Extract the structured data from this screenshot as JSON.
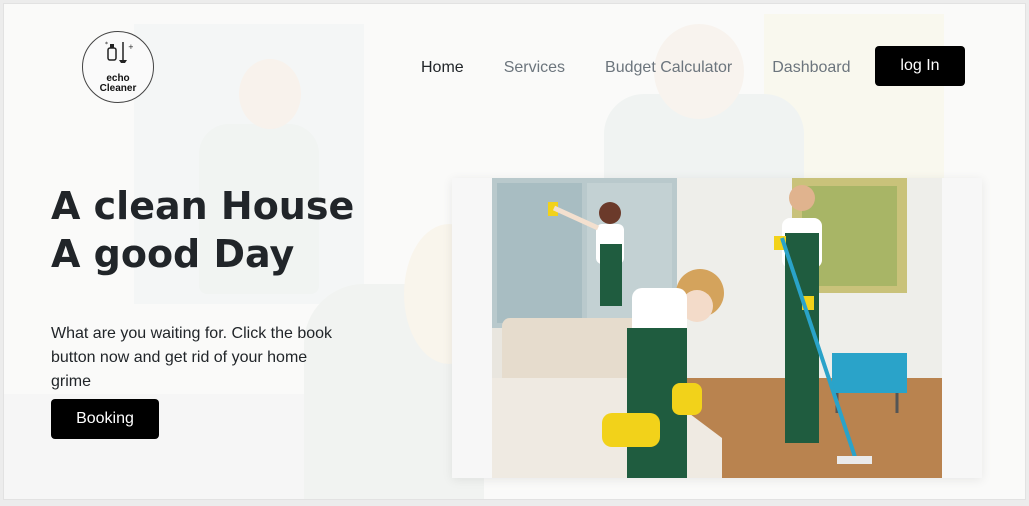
{
  "logo": {
    "line1": "echo",
    "line2": "Cleaner"
  },
  "nav": {
    "items": [
      {
        "label": "Home",
        "active": true
      },
      {
        "label": "Services",
        "active": false
      },
      {
        "label": "Budget Calculator",
        "active": false
      },
      {
        "label": "Dashboard",
        "active": false
      }
    ],
    "login_label": "log In"
  },
  "hero": {
    "title_line1": "A clean House",
    "title_line2": "A good Day",
    "text": "What are you waiting for. Click the book button now and get rid of your home grime",
    "booking_label": "Booking"
  },
  "colors": {
    "button_bg": "#000000",
    "button_text": "#ffffff",
    "nav_active": "#212529",
    "nav_inactive": "#6c757d",
    "overall_green": "#1f5c3f",
    "glove_yellow": "#f2d21a"
  },
  "icons": {
    "logo": "cleaning-supplies-icon"
  }
}
